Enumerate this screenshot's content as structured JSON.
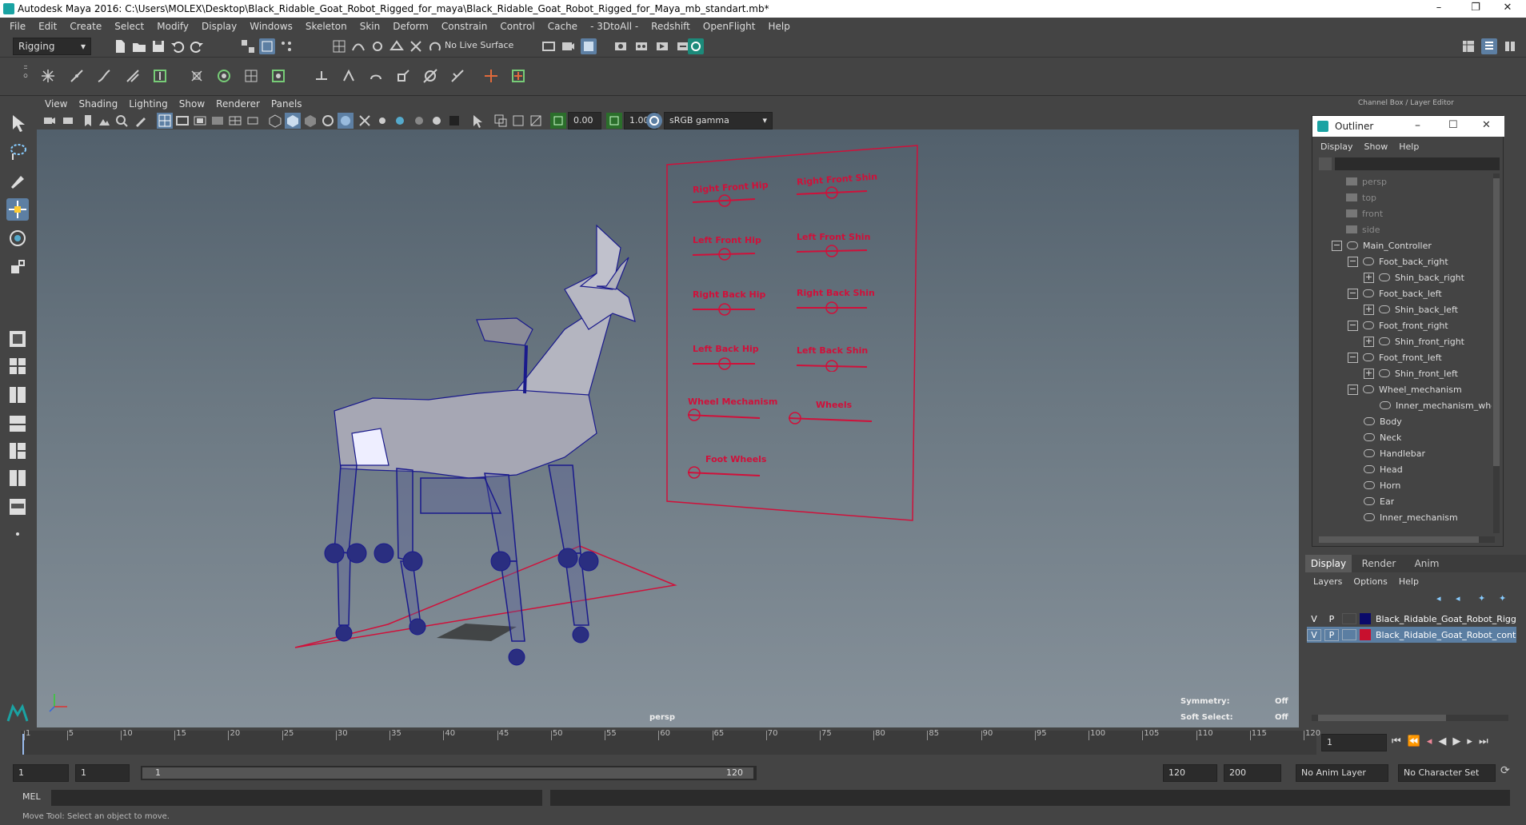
{
  "window": {
    "title": "Autodesk Maya 2016: C:\\Users\\MOLEX\\Desktop\\Black_Ridable_Goat_Robot_Rigged_for_maya\\Black_Ridable_Goat_Robot_Rigged_for_Maya_mb_standart.mb*",
    "minimize": "–",
    "restore": "❐",
    "close": "✕"
  },
  "menubar": [
    "File",
    "Edit",
    "Create",
    "Select",
    "Modify",
    "Display",
    "Windows",
    "Skeleton",
    "Skin",
    "Deform",
    "Constrain",
    "Control",
    "Cache",
    "- 3DtoAll -",
    "Redshift",
    "OpenFlight",
    "Help"
  ],
  "statusline": {
    "menu_set": "Rigging",
    "live_surface": "No Live Surface"
  },
  "viewport": {
    "menu": [
      "View",
      "Shading",
      "Lighting",
      "Show",
      "Renderer",
      "Panels"
    ],
    "exposure": "0.00",
    "gamma": "1.00",
    "color_space": "sRGB gamma",
    "camera_label": "persp",
    "hud": {
      "symmetry_label": "Symmetry:",
      "symmetry_value": "Off",
      "soft_select_label": "Soft Select:",
      "soft_select_value": "Off"
    },
    "control_board": {
      "labels": [
        "Right Front Hip",
        "Right Front Shin",
        "Left Front Hip",
        "Left Front Shin",
        "Right Back Hip",
        "Right Back Shin",
        "Left Back Hip",
        "Left Back Shin",
        "Wheel Mechanism",
        "Wheels",
        "Foot Wheels"
      ]
    },
    "colors": {
      "wire": "#1a1a8c",
      "controls": "#d0103a"
    }
  },
  "channel_box_title": "Channel Box / Layer Editor",
  "outliner": {
    "title": "Outliner",
    "menu": [
      "Display",
      "Show",
      "Help"
    ],
    "items": [
      {
        "label": "persp",
        "type": "camera"
      },
      {
        "label": "top",
        "type": "camera"
      },
      {
        "label": "front",
        "type": "camera"
      },
      {
        "label": "side",
        "type": "camera"
      },
      {
        "label": "Main_Controller",
        "expand": "−"
      },
      {
        "label": "Foot_back_right",
        "expand": "−"
      },
      {
        "label": "Shin_back_right",
        "expand": "+"
      },
      {
        "label": "Foot_back_left",
        "expand": "−"
      },
      {
        "label": "Shin_back_left",
        "expand": "+"
      },
      {
        "label": "Foot_front_right",
        "expand": "−"
      },
      {
        "label": "Shin_front_right",
        "expand": "+"
      },
      {
        "label": "Foot_front_left",
        "expand": "−"
      },
      {
        "label": "Shin_front_left",
        "expand": "+"
      },
      {
        "label": "Wheel_mechanism",
        "expand": "−"
      },
      {
        "label": "Inner_mechanism_whee",
        "expand": ""
      },
      {
        "label": "Body",
        "expand": ""
      },
      {
        "label": "Neck",
        "expand": ""
      },
      {
        "label": "Handlebar",
        "expand": ""
      },
      {
        "label": "Head",
        "expand": ""
      },
      {
        "label": "Horn",
        "expand": ""
      },
      {
        "label": "Ear",
        "expand": ""
      },
      {
        "label": "Inner_mechanism",
        "expand": ""
      }
    ]
  },
  "layer_editor": {
    "tabs": [
      "Display",
      "Render",
      "Anim"
    ],
    "menu": [
      "Layers",
      "Options",
      "Help"
    ],
    "layers": [
      {
        "v": "V",
        "p": "P",
        "name": "Black_Ridable_Goat_Robot_Rigg",
        "color": "#0a0a6a"
      },
      {
        "v": "V",
        "p": "P",
        "name": "Black_Ridable_Goat_Robot_cont",
        "color": "#c8102e"
      }
    ]
  },
  "timeline": {
    "ticks": [
      "1",
      "5",
      "10",
      "15",
      "20",
      "25",
      "30",
      "35",
      "40",
      "45",
      "50",
      "55",
      "60",
      "65",
      "70",
      "75",
      "80",
      "85",
      "90",
      "95",
      "100",
      "105",
      "110",
      "115",
      "120"
    ],
    "current_frame": "1"
  },
  "range": {
    "start": "1",
    "playback_start": "1",
    "slider_start": "1",
    "slider_end": "120",
    "playback_end": "120",
    "end": "200",
    "anim_layer": "No Anim Layer",
    "character_set": "No Character Set"
  },
  "cmdline": {
    "label": "MEL"
  },
  "helpline": "Move Tool: Select an object to move."
}
